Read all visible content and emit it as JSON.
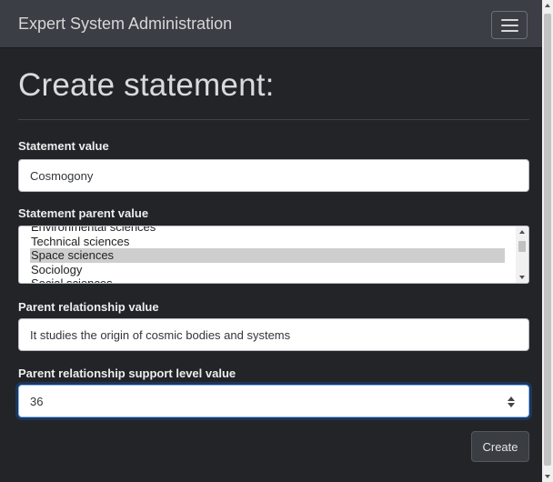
{
  "navbar": {
    "brand": "Expert System Administration",
    "toggle_icon": "hamburger-menu-icon"
  },
  "page": {
    "title": "Create statement:"
  },
  "form": {
    "statement_value": {
      "label": "Statement value",
      "value": "Cosmogony"
    },
    "statement_parent_value": {
      "label": "Statement parent value",
      "options": [
        "Environmental sciences",
        "Technical sciences",
        "Space sciences",
        "Sociology",
        "Social sciences"
      ],
      "selected": "Space sciences"
    },
    "parent_relationship_value": {
      "label": "Parent relationship value",
      "value": "It studies the origin of cosmic bodies and systems"
    },
    "parent_relationship_support_level_value": {
      "label": "Parent relationship support level value",
      "value": "36"
    },
    "submit_label": "Create"
  },
  "colors": {
    "background": "#232427",
    "navbar": "#3b3e44",
    "selected_option": "#cecece",
    "focus_ring": "#86b7fe"
  }
}
